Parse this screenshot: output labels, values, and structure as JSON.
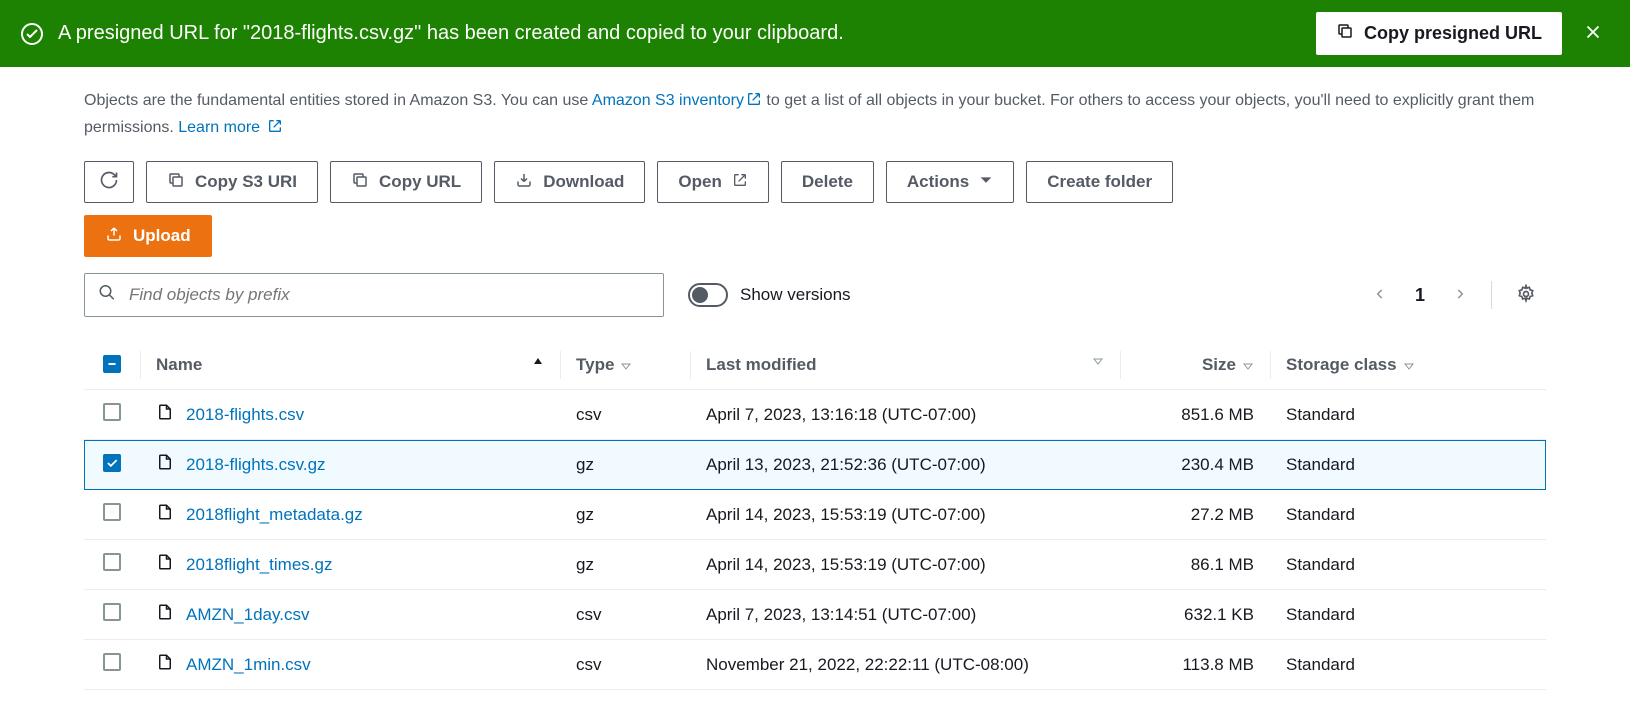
{
  "notification": {
    "message": "A presigned URL for \"2018-flights.csv.gz\" has been created and copied to your clipboard.",
    "copy_button": "Copy presigned URL"
  },
  "description": {
    "text1": "Objects are the fundamental entities stored in Amazon S3. You can use ",
    "link1": "Amazon S3 inventory",
    "text2": " to get a list of all objects in your bucket. For others to access your objects, you'll need to explicitly grant them permissions. ",
    "link2": "Learn more"
  },
  "toolbar": {
    "copy_s3_uri": "Copy S3 URI",
    "copy_url": "Copy URL",
    "download": "Download",
    "open": "Open",
    "delete": "Delete",
    "actions": "Actions",
    "create_folder": "Create folder",
    "upload": "Upload"
  },
  "filter": {
    "search_placeholder": "Find objects by prefix",
    "show_versions": "Show versions"
  },
  "pagination": {
    "page": "1"
  },
  "table": {
    "headers": {
      "name": "Name",
      "type": "Type",
      "last_modified": "Last modified",
      "size": "Size",
      "storage_class": "Storage class"
    },
    "rows": [
      {
        "selected": false,
        "name": "2018-flights.csv",
        "type": "csv",
        "modified": "April 7, 2023, 13:16:18 (UTC-07:00)",
        "size": "851.6 MB",
        "storage": "Standard"
      },
      {
        "selected": true,
        "name": "2018-flights.csv.gz",
        "type": "gz",
        "modified": "April 13, 2023, 21:52:36 (UTC-07:00)",
        "size": "230.4 MB",
        "storage": "Standard"
      },
      {
        "selected": false,
        "name": "2018flight_metadata.gz",
        "type": "gz",
        "modified": "April 14, 2023, 15:53:19 (UTC-07:00)",
        "size": "27.2 MB",
        "storage": "Standard"
      },
      {
        "selected": false,
        "name": "2018flight_times.gz",
        "type": "gz",
        "modified": "April 14, 2023, 15:53:19 (UTC-07:00)",
        "size": "86.1 MB",
        "storage": "Standard"
      },
      {
        "selected": false,
        "name": "AMZN_1day.csv",
        "type": "csv",
        "modified": "April 7, 2023, 13:14:51 (UTC-07:00)",
        "size": "632.1 KB",
        "storage": "Standard"
      },
      {
        "selected": false,
        "name": "AMZN_1min.csv",
        "type": "csv",
        "modified": "November 21, 2022, 22:22:11 (UTC-08:00)",
        "size": "113.8 MB",
        "storage": "Standard"
      }
    ]
  }
}
